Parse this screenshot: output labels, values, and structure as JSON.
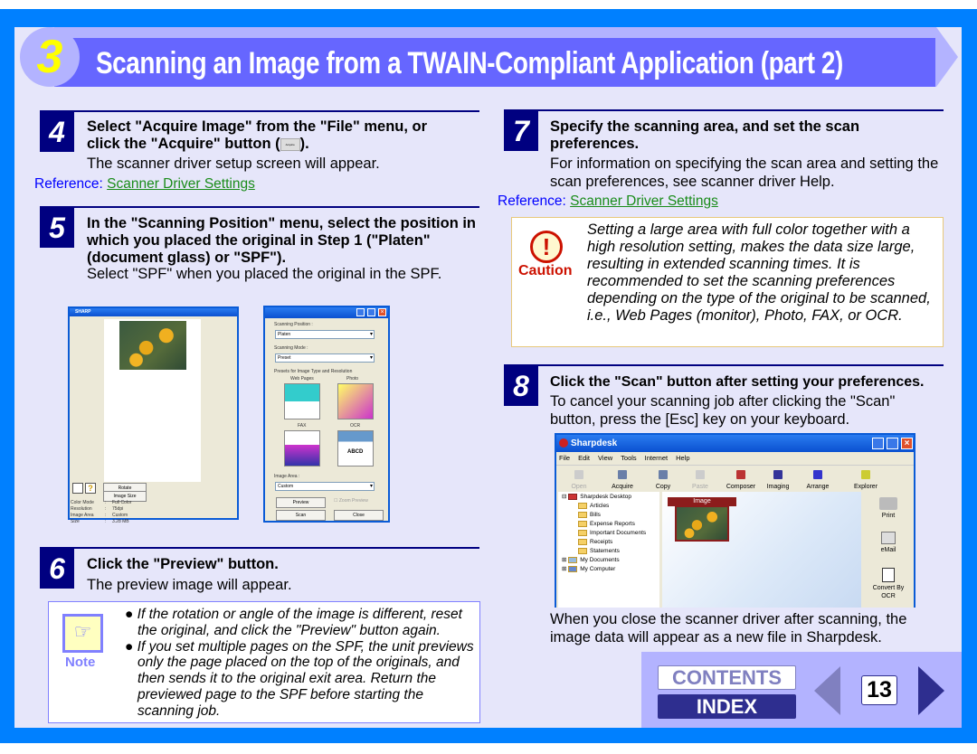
{
  "header": {
    "number": "3",
    "title": "Scanning an Image from a TWAIN-Compliant Application (part 2)"
  },
  "steps": {
    "s4": {
      "num": "4",
      "title_a": "Select \"Acquire Image\" from the \"File\" menu, or",
      "title_b": "click the \"Acquire\" button (",
      "title_c": ").",
      "button_icon_label": "Acquire",
      "body": "The scanner driver setup screen will appear.",
      "ref_label": "Reference:",
      "ref_link": "Scanner Driver Settings"
    },
    "s5": {
      "num": "5",
      "title": "In the \"Scanning Position\" menu, select the position in which you placed the original in Step 1 (\"Platen\" (document glass) or \"SPF\").",
      "body": "Select \"SPF\" when you placed the original in the SPF."
    },
    "s6": {
      "num": "6",
      "title": "Click the \"Preview\" button.",
      "body": "The preview image will appear."
    },
    "s7": {
      "num": "7",
      "title": "Specify the scanning area, and set the scan preferences.",
      "body": "For information on specifying the scan area and setting the scan preferences, see scanner driver Help.",
      "ref_label": "Reference:",
      "ref_link": "Scanner Driver Settings"
    },
    "s8": {
      "num": "8",
      "title": "Click the \"Scan\" button after setting your preferences.",
      "body": "To cancel your scanning job after clicking the \"Scan\" button, press the [Esc] key on your keyboard.",
      "after": "When you close the scanner driver after scanning, the image data will appear as a new file in Sharpdesk."
    }
  },
  "note": {
    "label": "Note",
    "items": [
      "If the rotation or angle of the image is different, reset the original, and click the \"Preview\" button again.",
      "If you set multiple pages on the SPF, the unit previews only the page placed on the top of the originals, and then sends it to the original exit area. Return the previewed page to the SPF before starting the scanning job."
    ]
  },
  "caution": {
    "label": "Caution",
    "text": "Setting a large area with full color together with a high resolution setting, makes the data size large, resulting in extended scanning times. It is recommended to set the scanning preferences depending on the type of the original to be scanned, i.e., Web Pages (monitor), Photo, FAX, or OCR."
  },
  "preview_window": {
    "title": "SHARP",
    "rotate": "Rotate",
    "image_size": "Image Size",
    "info": [
      [
        "Color Mode",
        ":",
        "Full Color"
      ],
      [
        "Resolution",
        ":",
        "75dpi"
      ],
      [
        "Image Area",
        ":",
        "Custom"
      ],
      [
        "Size",
        ":",
        "3.28 MB"
      ]
    ]
  },
  "driver_window": {
    "scanning_position_label": "Scanning Position :",
    "scanning_position": "Platen",
    "scanning_mode_label": "Scanning Mode :",
    "scanning_mode": "Preset",
    "presets_label": "Presets for Image Type and Resolution",
    "presets": [
      "Web Pages",
      "Photo",
      "FAX",
      "OCR"
    ],
    "ocr_sample": "ABCD",
    "image_area_label": "Image Area :",
    "image_area": "Custom",
    "preview": "Preview",
    "zoom_preview": "Zoom Preview",
    "scan": "Scan",
    "close": "Close"
  },
  "sharpdesk": {
    "title": "Sharpdesk",
    "menu": [
      "File",
      "Edit",
      "View",
      "Tools",
      "Internet",
      "Help"
    ],
    "toolbar": [
      "Open",
      "Acquire",
      "Copy",
      "Paste",
      "Composer",
      "Imaging",
      "Arrange",
      "Explorer"
    ],
    "tree": {
      "root": "Sharpdesk Desktop",
      "folders": [
        "Articles",
        "Bills",
        "Expense Reports",
        "Important Documents",
        "Receipts",
        "Statements"
      ],
      "others": [
        "My Documents",
        "My Computer"
      ]
    },
    "image_label": "Image",
    "actions": [
      "Print",
      "eMail",
      "Convert By OCR"
    ]
  },
  "nav": {
    "contents": "CONTENTS",
    "index": "INDEX",
    "page": "13"
  },
  "colors": {
    "frame": "#0080ff",
    "background": "#e6e6fa",
    "header_bar": "#6666ff",
    "step_box": "#000080",
    "link": "#1a8c1a",
    "caution": "#cc1100",
    "note": "#8080ff"
  }
}
